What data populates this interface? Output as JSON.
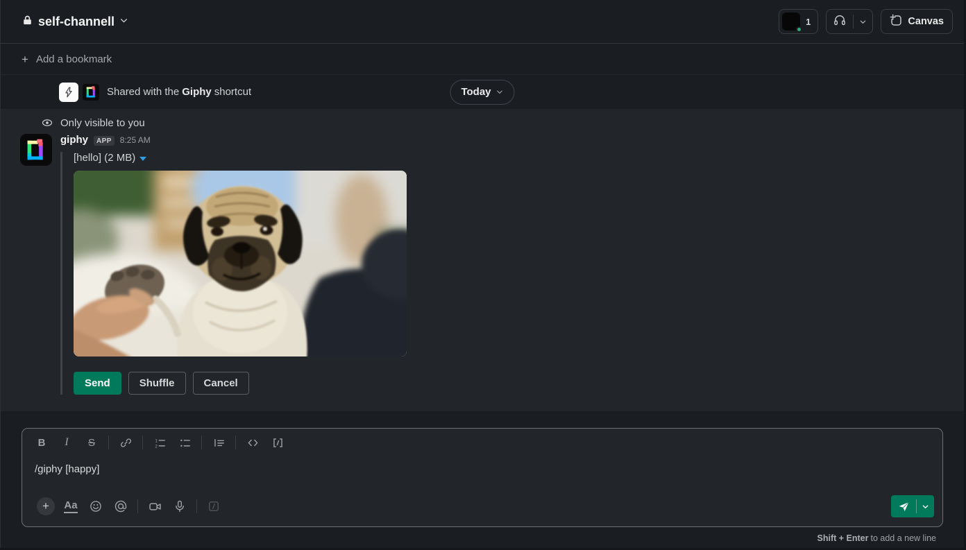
{
  "header": {
    "channel_name": "self-channell",
    "member_count": "1",
    "canvas_label": "Canvas"
  },
  "bookmarks": {
    "add_label": "Add a bookmark"
  },
  "banner": {
    "prefix": "Shared with the",
    "app_name": "Giphy",
    "suffix": "shortcut",
    "date_label": "Today"
  },
  "message": {
    "visibility_note": "Only visible to you",
    "sender": "giphy",
    "app_badge": "APP",
    "timestamp": "8:25 AM",
    "attachment_label": "[hello] (2 MB)",
    "send_label": "Send",
    "shuffle_label": "Shuffle",
    "cancel_label": "Cancel"
  },
  "composer": {
    "bold_glyph": "B",
    "italic_glyph": "I",
    "strike_glyph": "S",
    "input_value": "/giphy [happy]",
    "text_format_label": "Aa",
    "hint_bold": "Shift + Enter",
    "hint_rest": " to add a new line"
  },
  "colors": {
    "accent_green": "#007a5a",
    "presence_green": "#2bac76",
    "link_blue": "#2e9fe0",
    "background": "#1a1d21",
    "message_pane": "#222529"
  }
}
